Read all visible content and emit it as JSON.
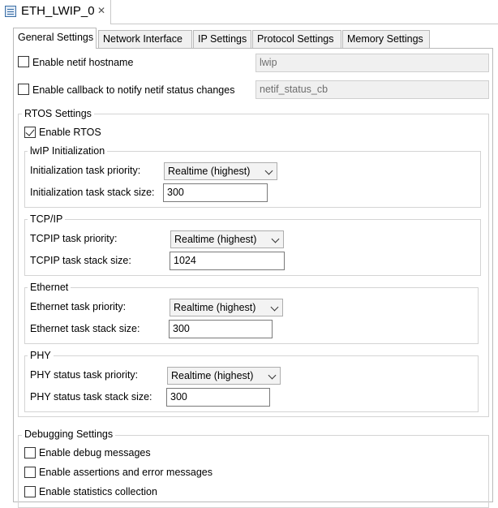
{
  "editor": {
    "title": "ETH_LWIP_0",
    "close": "✕"
  },
  "tabs": [
    {
      "label": "General Settings"
    },
    {
      "label": "Network Interface"
    },
    {
      "label": "IP Settings"
    },
    {
      "label": "Protocol Settings"
    },
    {
      "label": "Memory Settings"
    }
  ],
  "general": {
    "hostname": {
      "label": "Enable netif hostname",
      "checked": false,
      "value": "lwip"
    },
    "callback": {
      "label": "Enable callback to notify netif status changes",
      "checked": false,
      "value": "netif_status_cb"
    }
  },
  "rtos": {
    "title": "RTOS Settings",
    "enable_label": "Enable RTOS",
    "enabled": true,
    "lwip_init": {
      "title": "lwIP Initialization",
      "priority_label": "Initialization task priority:",
      "priority_value": "Realtime (highest)",
      "stack_label": "Initialization task stack size:",
      "stack_value": "300"
    },
    "tcpip": {
      "title": "TCP/IP",
      "priority_label": "TCPIP task priority:",
      "priority_value": "Realtime (highest)",
      "stack_label": "TCPIP task stack size:",
      "stack_value": "1024"
    },
    "ethernet": {
      "title": "Ethernet",
      "priority_label": "Ethernet task priority:",
      "priority_value": "Realtime (highest)",
      "stack_label": "Ethernet task stack size:",
      "stack_value": "300"
    },
    "phy": {
      "title": "PHY",
      "priority_label": "PHY status task priority:",
      "priority_value": "Realtime (highest)",
      "stack_label": "PHY status task stack size:",
      "stack_value": "300"
    }
  },
  "debugging": {
    "title": "Debugging Settings",
    "debug_label": "Enable debug messages",
    "assert_label": "Enable assertions and error messages",
    "stats_label": "Enable statistics collection"
  }
}
